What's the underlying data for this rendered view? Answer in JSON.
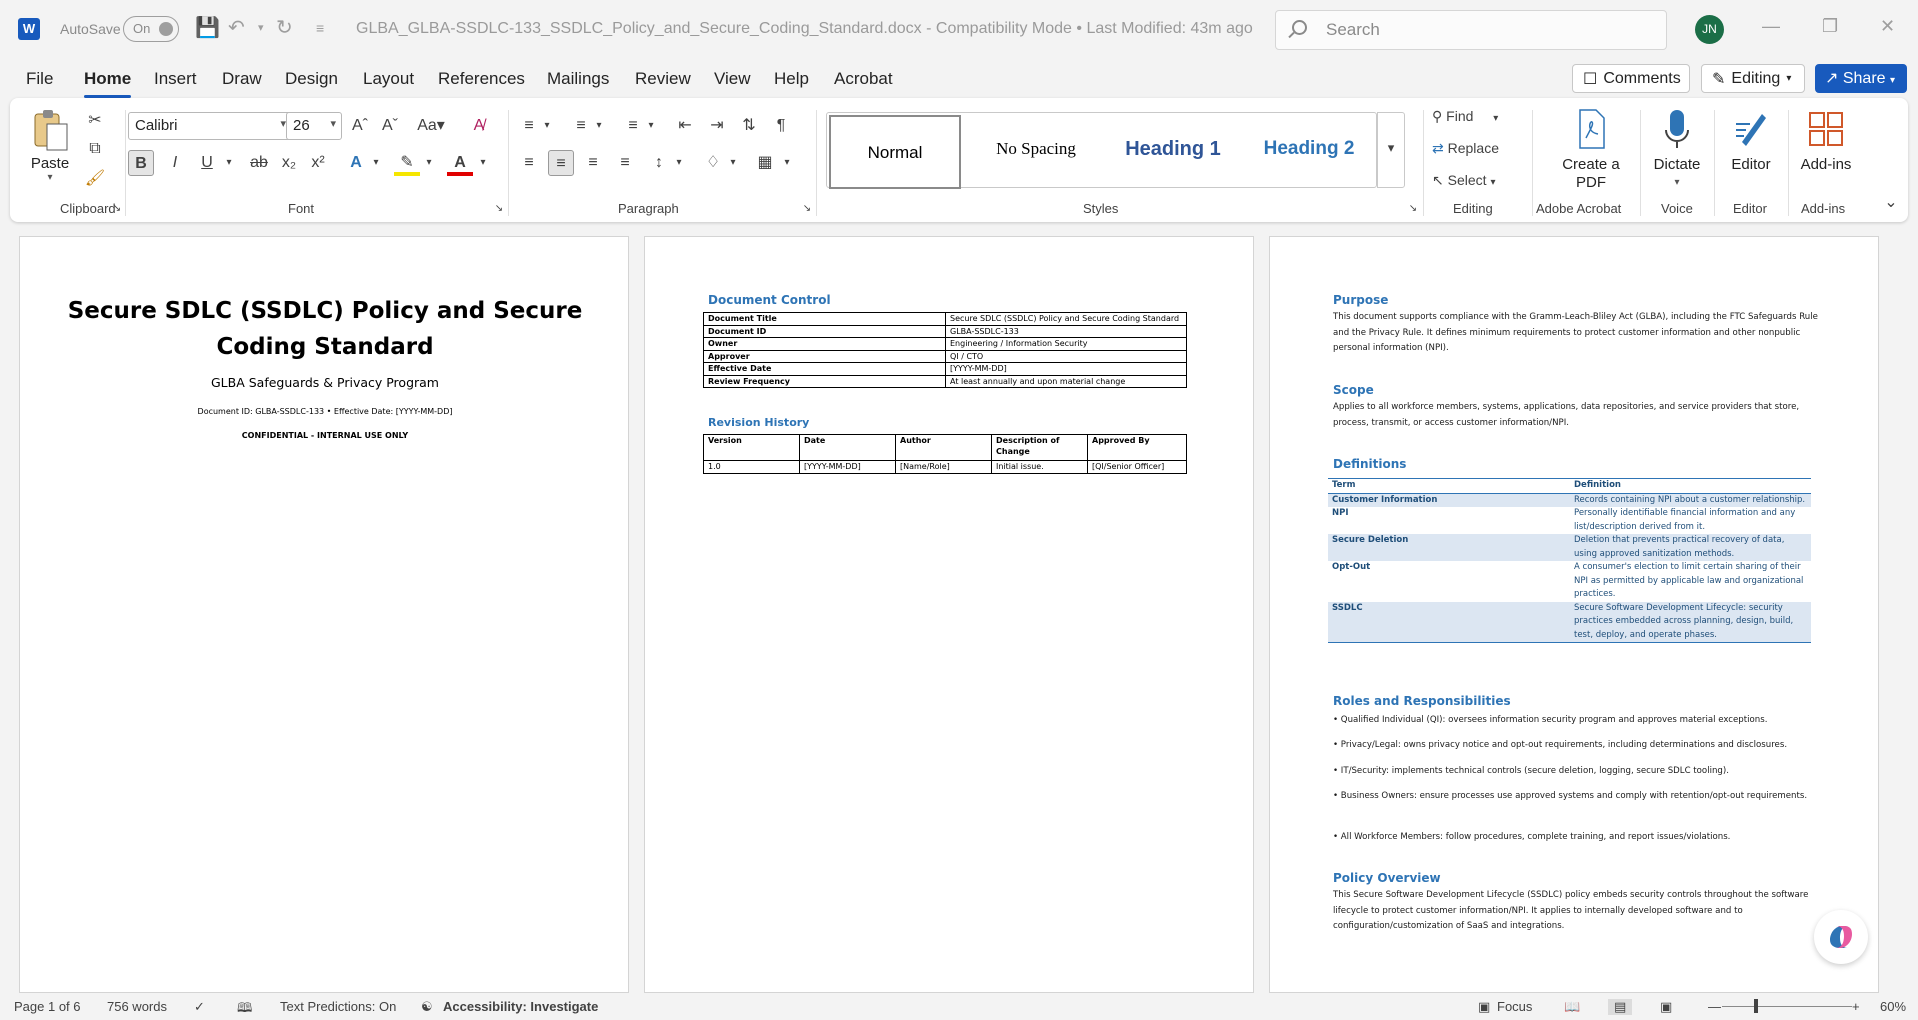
{
  "titlebar": {
    "autosave_label": "AutoSave",
    "autosave_state": "On",
    "document_title": "GLBA_GLBA-SSDLC-133_SSDLC_Policy_and_Secure_Coding_Standard.docx  -  Compatibility Mode  •  Last Modified: 43m ago",
    "search_placeholder": "Search",
    "user_initials": "JN"
  },
  "menu": {
    "tabs": [
      "File",
      "Home",
      "Insert",
      "Draw",
      "Design",
      "Layout",
      "References",
      "Mailings",
      "Review",
      "View",
      "Help",
      "Acrobat"
    ],
    "active": "Home",
    "comments_label": "Comments",
    "editing_label": "Editing",
    "share_label": "Share"
  },
  "ribbon": {
    "clipboard": {
      "paste_label": "Paste",
      "group_label": "Clipboard"
    },
    "font": {
      "family": "Calibri",
      "size": "26",
      "group_label": "Font"
    },
    "paragraph": {
      "group_label": "Paragraph"
    },
    "styles": {
      "items": [
        "Normal",
        "No Spacing",
        "Heading 1",
        "Heading 2"
      ],
      "group_label": "Styles"
    },
    "editing": {
      "find": "Find",
      "replace": "Replace",
      "select": "Select",
      "group_label": "Editing"
    },
    "acrobat": {
      "create_pdf": "Create a PDF",
      "group_label": "Adobe Acrobat"
    },
    "voice": {
      "dictate": "Dictate",
      "group_label": "Voice"
    },
    "editor": {
      "label": "Editor",
      "group_label": "Editor"
    },
    "addins": {
      "label": "Add-ins",
      "group_label": "Add-ins"
    }
  },
  "page1": {
    "title_line1": "Secure SDLC (SSDLC) Policy and Secure",
    "title_line2": "Coding Standard",
    "program": "GLBA Safeguards & Privacy Program",
    "doc_meta": "Document ID: GLBA-SSDLC-133 • Effective Date: [YYYY-MM-DD]",
    "confidential": "CONFIDENTIAL - INTERNAL USE ONLY"
  },
  "page2": {
    "doc_control_heading": "Document Control",
    "doc_control": [
      [
        "Document Title",
        "Secure SDLC (SSDLC) Policy and Secure Coding Standard"
      ],
      [
        "Document ID",
        "GLBA-SSDLC-133"
      ],
      [
        "Owner",
        "Engineering / Information Security"
      ],
      [
        "Approver",
        "QI / CTO"
      ],
      [
        "Effective Date",
        "[YYYY-MM-DD]"
      ],
      [
        "Review Frequency",
        "At least annually and upon material change"
      ]
    ],
    "revision_heading": "Revision History",
    "revision_headers": [
      "Version",
      "Date",
      "Author",
      "Description of Change",
      "Approved By"
    ],
    "revision_rows": [
      [
        "1.0",
        "[YYYY-MM-DD]",
        "[Name/Role]",
        "Initial issue.",
        "[QI/Senior Officer]"
      ]
    ]
  },
  "page3": {
    "purpose_heading": "Purpose",
    "purpose_text": "This document supports compliance with the Gramm-Leach-Bliley Act (GLBA), including the FTC Safeguards Rule and the Privacy Rule. It defines minimum requirements to protect customer information and other nonpublic personal information (NPI).",
    "scope_heading": "Scope",
    "scope_text": "Applies to all workforce members, systems, applications, data repositories, and service providers that store, process, transmit, or access customer information/NPI.",
    "definitions_heading": "Definitions",
    "definitions_headers": [
      "Term",
      "Definition"
    ],
    "definitions": [
      [
        "Customer Information",
        "Records containing NPI about a customer relationship."
      ],
      [
        "NPI",
        "Personally identifiable financial information and any list/description derived from it."
      ],
      [
        "Secure Deletion",
        "Deletion that prevents practical recovery of data, using approved sanitization methods."
      ],
      [
        "Opt-Out",
        "A consumer's election to limit certain sharing of their NPI as permitted by applicable law and organizational practices."
      ],
      [
        "SSDLC",
        "Secure Software Development Lifecycle: security practices embedded across planning, design, build, test, deploy, and operate phases."
      ]
    ],
    "roles_heading": "Roles and Responsibilities",
    "roles": [
      "• Qualified Individual (QI): oversees information security program and approves material exceptions.",
      "• Privacy/Legal: owns privacy notice and opt-out requirements, including determinations and disclosures.",
      "• IT/Security: implements technical controls (secure deletion, logging, secure SDLC tooling).",
      "• Business Owners: ensure processes use approved systems and comply with retention/opt-out requirements.",
      "• All Workforce Members: follow procedures, complete training, and report issues/violations."
    ],
    "overview_heading": "Policy Overview",
    "overview_text": "This Secure Software Development Lifecycle (SSDLC) policy embeds security controls throughout the software lifecycle to protect customer information/NPI. It applies to internally developed software and to configuration/customization of SaaS and integrations."
  },
  "statusbar": {
    "page": "Page 1 of 6",
    "words": "756 words",
    "text_predictions": "Text Predictions: On",
    "accessibility": "Accessibility: Investigate",
    "focus": "Focus",
    "zoom": "60%"
  },
  "colors": {
    "accent": "#185abd",
    "heading_blue": "#2e74b5",
    "avatar": "#1b6e47"
  }
}
